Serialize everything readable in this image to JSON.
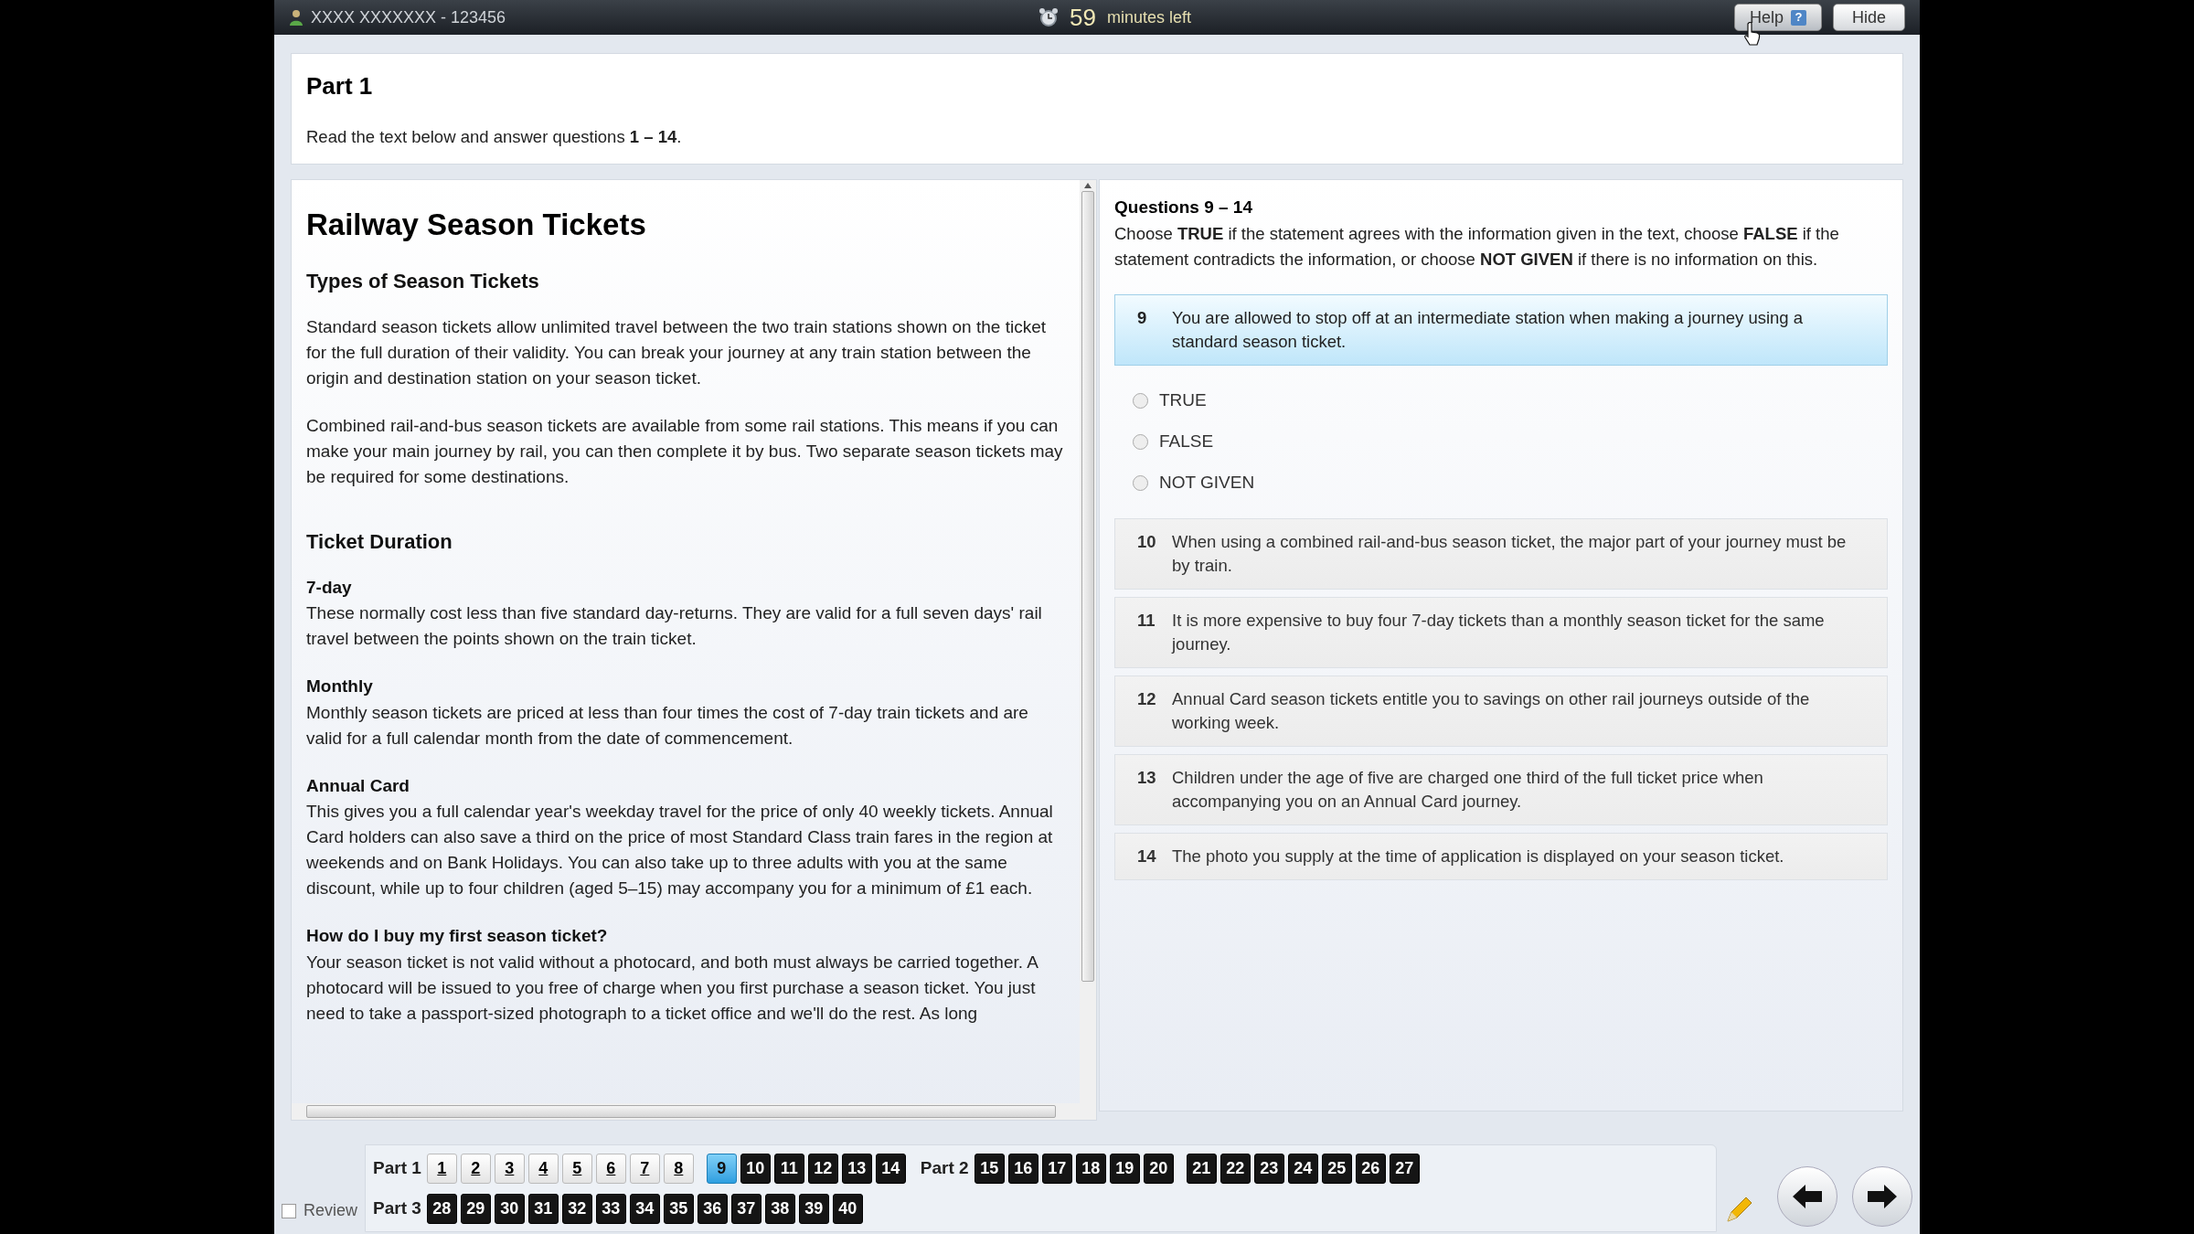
{
  "top_bar": {
    "candidate": "XXXX XXXXXXX - 123456",
    "minutes": "59",
    "minutes_label": "minutes left",
    "help_button": "Help",
    "help_glyph": "?",
    "hide_button": "Hide"
  },
  "header": {
    "title": "Part 1",
    "instruction": "Read the text below and answer questions **1 – 14**."
  },
  "passage": [
    {
      "kind": "title",
      "text": "Railway Season Tickets"
    },
    {
      "kind": "heading",
      "text": "Types of Season Tickets"
    },
    {
      "kind": "paragraph",
      "text": "Standard season tickets allow unlimited travel between the two train stations shown on the ticket for the full duration of their validity. You can break your journey at any train station between the origin and destination station on your season ticket."
    },
    {
      "kind": "paragraph",
      "text": "Combined rail-and-bus season tickets are available from some rail stations. This means if you can make your main journey by rail, you can then complete it by bus. Two separate season tickets may be required for some destinations."
    },
    {
      "kind": "heading",
      "text": "Ticket Duration"
    },
    {
      "kind": "subheading",
      "text": "7-day"
    },
    {
      "kind": "paragraph",
      "text": "These normally cost less than five standard day-returns. They are valid for a full seven days' rail travel between the points shown on the train ticket."
    },
    {
      "kind": "subheading",
      "text": "Monthly"
    },
    {
      "kind": "paragraph",
      "text": "Monthly season tickets are priced at less than four times the cost of 7-day train tickets and are valid for a full calendar month from the date of commencement."
    },
    {
      "kind": "subheading",
      "text": "Annual Card"
    },
    {
      "kind": "paragraph",
      "text": "This gives you a full calendar year's weekday travel for the price of only 40 weekly tickets. Annual Card holders can also save a third on the price of most Standard Class train fares in the region at weekends and on Bank Holidays. You can also take up to three adults with you at the same discount, while up to four children (aged 5–15) may accompany you for a minimum of £1 each."
    },
    {
      "kind": "subheading",
      "text": "How do I buy my first season ticket?"
    },
    {
      "kind": "paragraph",
      "text": "Your season ticket is not valid without a photocard, and both must always be carried together. A photocard will be issued to you free of charge when you first purchase a season ticket. You just need to take a passport-sized photograph to a ticket office and we'll do the rest. As long"
    }
  ],
  "questions_panel": {
    "title": "Questions 9 – 14",
    "instruction": "Choose **TRUE** if the statement agrees with the information given in the text, choose **FALSE** if the statement contradicts the information, or choose **NOT GIVEN** if there is no information on this.",
    "questions": [
      {
        "number": "9",
        "text": "You are allowed to stop off at an intermediate station when making a journey using a standard season ticket.",
        "selected": true,
        "options": [
          {
            "label": "TRUE",
            "checked": false
          },
          {
            "label": "FALSE",
            "checked": false
          },
          {
            "label": "NOT GIVEN",
            "checked": false
          }
        ]
      },
      {
        "number": "10",
        "text": "When using a combined rail-and-bus season ticket, the major part of your journey must be by train.",
        "selected": false
      },
      {
        "number": "11",
        "text": "It is more expensive to buy four 7-day tickets than a monthly season ticket for the same journey.",
        "selected": false
      },
      {
        "number": "12",
        "text": "Annual Card season tickets entitle you to savings on other rail journeys outside of the working week.",
        "selected": false
      },
      {
        "number": "13",
        "text": "Children under the age of five are charged one third of the full ticket price when accompanying you on an Annual Card journey.",
        "selected": false
      },
      {
        "number": "14",
        "text": "The photo you supply at the time of application is displayed on your season ticket.",
        "selected": false
      }
    ]
  },
  "navigation": {
    "review": {
      "label": "Review",
      "checked": false
    },
    "rows": [
      [
        {
          "label": "Part 1",
          "groups": [
            [
              {
                "n": "1",
                "answered": true,
                "selected": false
              },
              {
                "n": "2",
                "answered": true,
                "selected": false
              },
              {
                "n": "3",
                "answered": true,
                "selected": false
              },
              {
                "n": "4",
                "answered": true,
                "selected": false
              },
              {
                "n": "5",
                "answered": true,
                "selected": false
              },
              {
                "n": "6",
                "answered": true,
                "selected": false
              },
              {
                "n": "7",
                "answered": true,
                "selected": false
              },
              {
                "n": "8",
                "answered": true,
                "selected": false
              }
            ],
            [
              {
                "n": "9",
                "answered": false,
                "selected": true
              },
              {
                "n": "10",
                "answered": false,
                "selected": false
              },
              {
                "n": "11",
                "answered": false,
                "selected": false
              },
              {
                "n": "12",
                "answered": false,
                "selected": false
              },
              {
                "n": "13",
                "answered": false,
                "selected": false
              },
              {
                "n": "14",
                "answered": false,
                "selected": false
              }
            ]
          ]
        },
        {
          "label": "Part 2",
          "groups": [
            [
              {
                "n": "15",
                "answered": false,
                "selected": false
              },
              {
                "n": "16",
                "answered": false,
                "selected": false
              },
              {
                "n": "17",
                "answered": false,
                "selected": false
              },
              {
                "n": "18",
                "answered": false,
                "selected": false
              },
              {
                "n": "19",
                "answered": false,
                "selected": false
              },
              {
                "n": "20",
                "answered": false,
                "selected": false
              }
            ],
            [
              {
                "n": "21",
                "answered": false,
                "selected": false
              },
              {
                "n": "22",
                "answered": false,
                "selected": false
              },
              {
                "n": "23",
                "answered": false,
                "selected": false
              },
              {
                "n": "24",
                "answered": false,
                "selected": false
              },
              {
                "n": "25",
                "answered": false,
                "selected": false
              },
              {
                "n": "26",
                "answered": false,
                "selected": false
              },
              {
                "n": "27",
                "answered": false,
                "selected": false
              }
            ]
          ]
        }
      ],
      [
        {
          "label": "Part 3",
          "groups": [
            [
              {
                "n": "28",
                "answered": false,
                "selected": false
              },
              {
                "n": "29",
                "answered": false,
                "selected": false
              },
              {
                "n": "30",
                "answered": false,
                "selected": false
              },
              {
                "n": "31",
                "answered": false,
                "selected": false
              },
              {
                "n": "32",
                "answered": false,
                "selected": false
              },
              {
                "n": "33",
                "answered": false,
                "selected": false
              },
              {
                "n": "34",
                "answered": false,
                "selected": false
              },
              {
                "n": "35",
                "answered": false,
                "selected": false
              },
              {
                "n": "36",
                "answered": false,
                "selected": false
              },
              {
                "n": "37",
                "answered": false,
                "selected": false
              },
              {
                "n": "38",
                "answered": false,
                "selected": false
              },
              {
                "n": "39",
                "answered": false,
                "selected": false
              },
              {
                "n": "40",
                "answered": false,
                "selected": false
              }
            ]
          ]
        }
      ]
    ]
  }
}
